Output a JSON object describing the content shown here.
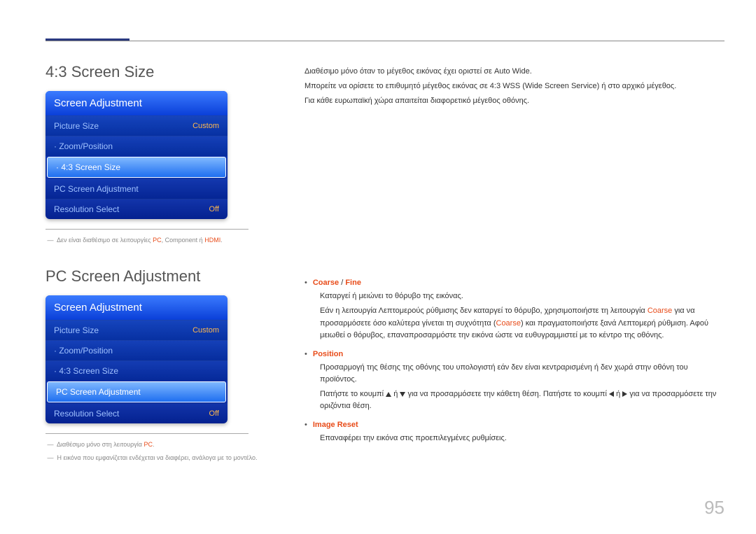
{
  "page_number": "95",
  "section1": {
    "title": "4:3 Screen Size",
    "osd_header": "Screen Adjustment",
    "rows": [
      {
        "label": "Picture Size",
        "value": "Custom",
        "selected": false
      },
      {
        "label": "· Zoom/Position",
        "value": "",
        "selected": false
      },
      {
        "label": "· 4:3 Screen Size",
        "value": "",
        "selected": true
      },
      {
        "label": "PC Screen Adjustment",
        "value": "",
        "selected": false
      },
      {
        "label": "Resolution Select",
        "value": "Off",
        "selected": false
      }
    ],
    "footnote_prefix": "Δεν είναι διαθέσιμο σε λειτουργίες ",
    "footnote_pc": "PC",
    "footnote_mid": ", Component ή ",
    "footnote_hdmi": "HDMI",
    "footnote_suffix": ".",
    "right": {
      "p1": "Διαθέσιμο μόνο όταν το μέγεθος εικόνας έχει οριστεί σε Auto Wide.",
      "p2": "Μπορείτε να ορίσετε το επιθυμητό μέγεθος εικόνας σε 4:3 WSS (Wide Screen Service) ή στο αρχικό μέγεθος.",
      "p3": "Για κάθε ευρωπαϊκή χώρα απαιτείται διαφορετικό μέγεθος οθόνης."
    }
  },
  "section2": {
    "title": "PC Screen Adjustment",
    "osd_header": "Screen Adjustment",
    "rows": [
      {
        "label": "Picture Size",
        "value": "Custom",
        "selected": false
      },
      {
        "label": "· Zoom/Position",
        "value": "",
        "selected": false
      },
      {
        "label": "· 4:3 Screen Size",
        "value": "",
        "selected": false
      },
      {
        "label": "PC Screen Adjustment",
        "value": "",
        "selected": true
      },
      {
        "label": "Resolution Select",
        "value": "Off",
        "selected": false
      }
    ],
    "footnote1_prefix": "Διαθέσιμο μόνο στη λειτουργία ",
    "footnote1_pc": "PC",
    "footnote1_suffix": ".",
    "footnote2": "Η εικόνα που εμφανίζεται ενδέχεται να διαφέρει, ανάλογα με το μοντέλο.",
    "right": {
      "b1_title_a": "Coarse",
      "b1_title_sep": " / ",
      "b1_title_b": "Fine",
      "b1_p1": "Καταργεί ή μειώνει το θόρυβο της εικόνας.",
      "b1_p2a": "Εάν η λειτουργία Λεπτομερούς ρύθμισης δεν καταργεί το θόρυβο, χρησιμοποιήστε τη λειτουργία ",
      "b1_p2b": " για να προσαρμόσετε όσο καλύτερα γίνεται τη συχνότητα (",
      "b1_p2c": ") και πραγματοποιήστε ξανά Λεπτομερή ρύθμιση. Αφού μειωθεί ο θόρυβος, επαναπροσαρμόστε την εικόνα ώστε να ευθυγραμμιστεί με το κέντρο της οθόνης.",
      "b1_coarse": "Coarse",
      "b2_title": "Position",
      "b2_p1": "Προσαρμογή της θέσης της οθόνης του υπολογιστή εάν δεν είναι κεντραρισμένη ή δεν χωρά στην οθόνη του προϊόντος.",
      "b2_p2a": "Πατήστε το κουμπί ",
      "b2_p2b": " ή ",
      "b2_p2c": " για να προσαρμόσετε την κάθετη θέση. Πατήστε το κουμπί ",
      "b2_p2d": " ή ",
      "b2_p2e": " για να προσαρμόσετε την οριζόντια θέση.",
      "b3_title": "Image Reset",
      "b3_p1": "Επαναφέρει την εικόνα στις προεπιλεγμένες ρυθμίσεις."
    }
  }
}
